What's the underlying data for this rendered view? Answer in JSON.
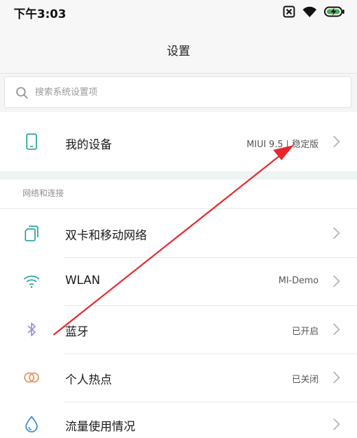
{
  "status_bar": {
    "time": "下午3:03",
    "icons": [
      "sim-blocked-icon",
      "wifi-icon",
      "battery-charging-icon"
    ]
  },
  "header": {
    "title": "设置"
  },
  "search": {
    "placeholder": "搜索系统设置项"
  },
  "device": {
    "label": "我的设备",
    "value": "MIUI 9.5 | 稳定版",
    "icon": "phone-icon"
  },
  "connection_section": {
    "header": "网络和连接",
    "items": [
      {
        "label": "双卡和移动网络",
        "value": "",
        "icon": "sim-cards-icon"
      },
      {
        "label": "WLAN",
        "value": "MI-Demo",
        "icon": "wifi-icon"
      },
      {
        "label": "蓝牙",
        "value": "已开启",
        "icon": "bluetooth-icon"
      },
      {
        "label": "个人热点",
        "value": "已关闭",
        "icon": "hotspot-icon"
      },
      {
        "label": "流量使用情况",
        "value": "",
        "icon": "data-usage-icon"
      }
    ]
  },
  "colors": {
    "accent_teal": "#2fa7a0",
    "bluetooth_purple": "#9b8fd9",
    "hotspot_orange": "#e8935b",
    "data_blue": "#3a8fd6",
    "annotation_red": "#e8262b"
  }
}
